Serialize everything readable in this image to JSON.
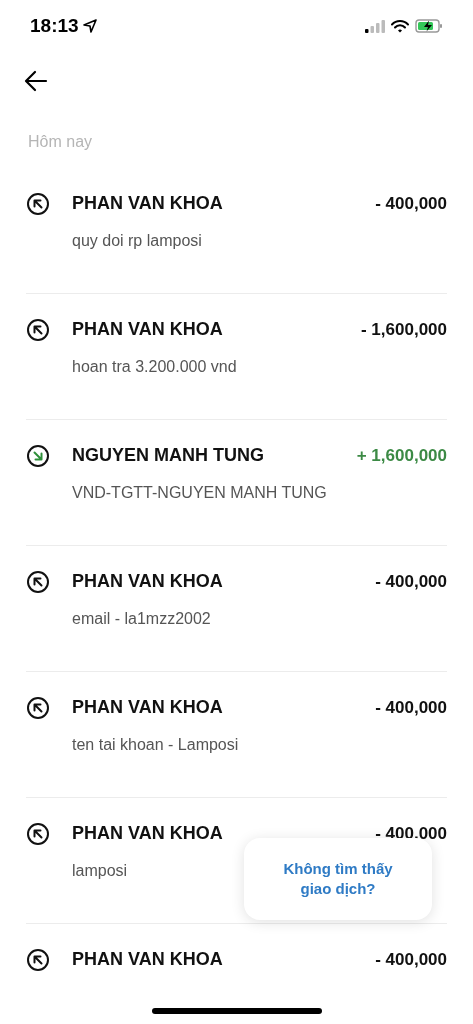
{
  "status_bar": {
    "time": "18:13"
  },
  "section_label": "Hôm nay",
  "transactions": [
    {
      "kind": "out",
      "name": "PHAN VAN KHOA",
      "note": "quy doi rp lamposi",
      "amount": "- 400,000"
    },
    {
      "kind": "out",
      "name": "PHAN VAN KHOA",
      "note": "hoan tra 3.200.000 vnd",
      "amount": "- 1,600,000"
    },
    {
      "kind": "in",
      "name": "NGUYEN MANH TUNG",
      "note": "VND-TGTT-NGUYEN MANH TUNG",
      "amount": "+ 1,600,000"
    },
    {
      "kind": "out",
      "name": "PHAN VAN KHOA",
      "note": "email - la1mzz2002",
      "amount": "- 400,000"
    },
    {
      "kind": "out",
      "name": "PHAN VAN KHOA",
      "note": "ten tai khoan - Lamposi",
      "amount": "- 400,000"
    },
    {
      "kind": "out",
      "name": "PHAN VAN KHOA",
      "note": "lamposi",
      "amount": "- 400,000"
    },
    {
      "kind": "out",
      "name": "PHAN VAN KHOA",
      "amount": "- 400,000"
    }
  ],
  "help_popup": {
    "label": "Không tìm thấy giao dịch?"
  }
}
